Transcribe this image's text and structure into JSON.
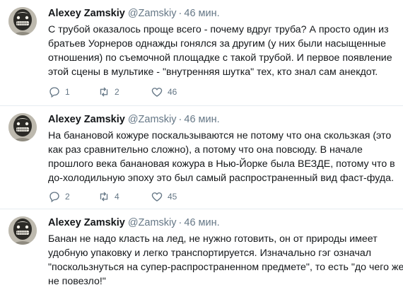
{
  "tweets": [
    {
      "author": "Alexey Zamskiy",
      "handle": "@Zamskiy",
      "separator": "·",
      "time": "46 мин.",
      "lines": [
        "С трубой оказалось проще всего - почему вдруг труба? А просто один из",
        "братьев Уорнеров однажды гонялся за другим (у них были насыщенные",
        "отношения) по съемочной площадке с такой трубой. И первое появление",
        "этой сцены в мультике - \"внутренняя шутка\" тех, кто знал сам анекдот."
      ],
      "replies": "1",
      "retweets": "2",
      "likes": "46"
    },
    {
      "author": "Alexey Zamskiy",
      "handle": "@Zamskiy",
      "separator": "·",
      "time": "46 мин.",
      "lines": [
        "На банановой кожуре поскальзываются не потому что она скользкая (это",
        "как раз сравнительно сложно), а потому что она повсюду. В начале",
        "прошлого века банановая кожура в Нью-Йорке была ВЕЗДЕ, потому что в",
        "до-холодильную эпоху это был самый распространенный вид фаст-фуда."
      ],
      "replies": "2",
      "retweets": "4",
      "likes": "45"
    },
    {
      "author": "Alexey Zamskiy",
      "handle": "@Zamskiy",
      "separator": "·",
      "time": "46 мин.",
      "lines": [
        "Банан не надо класть на лед, не нужно готовить, он от природы имеет",
        "удобную упаковку и легко транспортируется. Изначально гэг означал",
        "\"поскользнуться на супер-распространенном предмете\", то есть \"до чего же",
        "не повезло!\""
      ]
    }
  ],
  "icons": {
    "reply": "reply-icon",
    "retweet": "retweet-icon",
    "like": "heart-icon"
  },
  "colors": {
    "text": "#14171a",
    "secondary": "#657786",
    "divider": "#e6ecf0"
  }
}
